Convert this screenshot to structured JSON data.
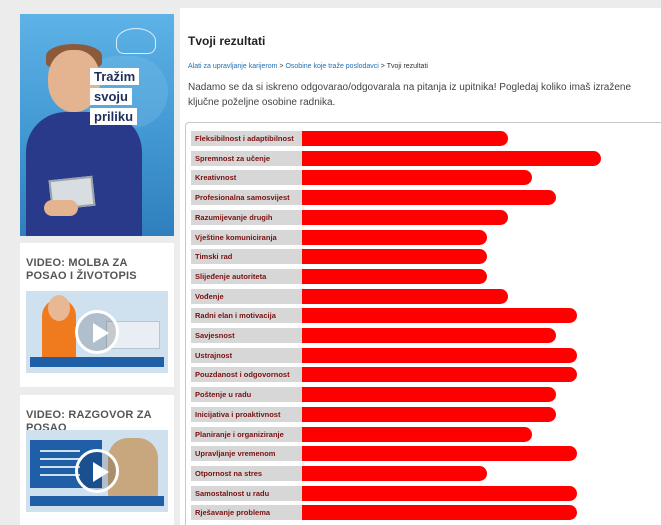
{
  "promo": {
    "lines": [
      "Tražim",
      "svoju",
      "priliku"
    ]
  },
  "videos": [
    {
      "title": "VIDEO: MOLBA ZA POSAO I ŽIVOTOPIS"
    },
    {
      "title": "VIDEO: RAZGOVOR ZA POSAO"
    }
  ],
  "main": {
    "title": "Tvoji rezultati",
    "breadcrumb": {
      "item1": "Alati za upravljanje karijerom",
      "sep1": " > ",
      "item2": "Osobine koje traže poslodavci",
      "sep2": " > ",
      "current": "Tvoji rezultati"
    },
    "intro": "Nadamo se da si iskreno odgovarao/odgovarala na pitanja iz upitnika! Pogledaj koliko imaš izražene ključne poželjne osobine radnika."
  },
  "chart_data": {
    "type": "bar",
    "categories": [
      "Fleksibilnost i adaptibilnost",
      "Spremnost za učenje",
      "Kreativnost",
      "Profesionalna samosvijest",
      "Razumijevanje drugih",
      "Vještine komuniciranja",
      "Timski rad",
      "Slijeđenje autoriteta",
      "Vođenje",
      "Radni elan i motivacija",
      "Savjesnost",
      "Ustrajnost",
      "Pouzdanost i odgovornost",
      "Poštenje u radu",
      "Inicijativa i proaktivnost",
      "Planiranje i organiziranje",
      "Upravljanje vremenom",
      "Otpornost na stres",
      "Samostalnost u radu",
      "Rješavanje problema"
    ],
    "values": [
      69,
      100,
      77,
      85,
      69,
      62,
      62,
      62,
      69,
      92,
      85,
      92,
      92,
      85,
      85,
      77,
      92,
      62,
      92,
      92
    ],
    "ylim": [
      0,
      100
    ],
    "bar_color": "#ff0000",
    "label_bg": "#d7d7d7",
    "label_color": "#7a1010"
  }
}
